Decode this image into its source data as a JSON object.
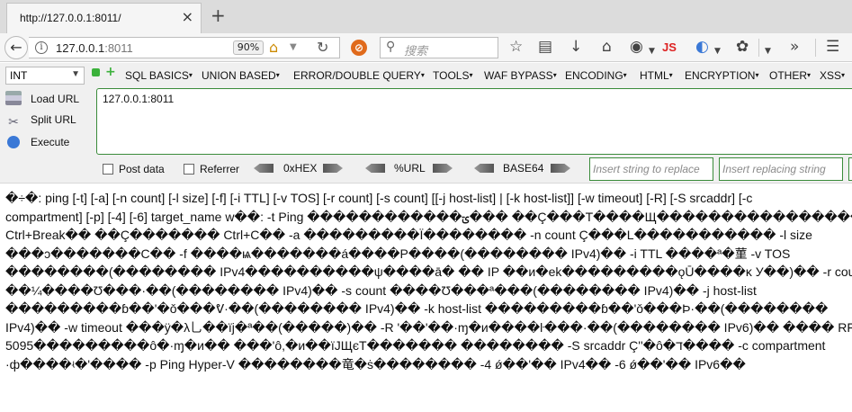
{
  "tab": {
    "title": "http://127.0.0.1:8011/",
    "close": "×"
  },
  "new_tab": "+",
  "nav": {
    "back": "←",
    "info": "i",
    "url_host": "127.0.0.1",
    "url_port": ":8011",
    "zoom": "90%",
    "search_placeholder": "搜索",
    "js_label": "JS"
  },
  "hackbar": {
    "select_value": "INT",
    "menus": [
      "SQL BASICS",
      "UNION BASED",
      "ERROR/DOUBLE QUERY",
      "TOOLS",
      "WAF BYPASS",
      "ENCODING",
      "HTML",
      "ENCRYPTION",
      "OTHER",
      "XSS"
    ],
    "actions": {
      "load": "Load URL",
      "split": "Split URL",
      "execute": "Execute"
    },
    "textarea_value": "127.0.0.1:8011",
    "post_data": "Post data",
    "referrer": "Referrer",
    "enc_hex": "0xHEX",
    "enc_url": "%URL",
    "enc_base64": "BASE64",
    "insert_placeholder": "Insert string to replace",
    "replace_placeholder": "Insert replacing string"
  },
  "content_lines": [
    "�÷�: ping [-t] [-a] [-n count] [-l size] [-f] [-i TTL] [-v TOS] [-r count] [-s count] [[-j host-list] | [-k host-list]] [-w timeout] [-R] [-S srcaddr] [-c",
    "compartment] [-p] [-4] [-6] target_name w��: -t Ping ������������ؾ��� ��Ç���T����Щ��������������������",
    "Ctrl+Break�� ��Ç�������  Ctrl+C��  -a ���������Ï��������  -n count Ç���L�����������  -l size",
    "���ɔ�������C��  -f ����ѩ�������á����P����(��������  IPv4)��  -i TTL ����ª�菫 -v TOS",
    "��������(��������  IPv4����������ψ����ā�  ��  IP  ��и�ek���������ǫŪ����κ  У��)��  -r count",
    "��¼����Ʊ���·��(��������  IPv4)��  -s count  ����Ʊ���ª���(��������  IPv4)��  -j host-list",
    "���������ɓ��ʹ�ǒ���ᕓ·��(��������  IPv4)��  -k host-list ���������ɓ��ʹǒ���Þ·��(��������",
    "IPv4)��  -w timeout ���ÿ�λ乚��ïj�ª��(�����)��  -R  ʹ��ʹ��·ɱ�и����ŀ���·��(��������  IPv6)��  ����  RFC",
    "5095���������ô�·ɱ�и��  ���ʹô,�и��ïJЩєТ�������  ��������  -S srcaddr Ç'ʹ�ô�ד����  -c compartment",
    "·ф����ʵ�ʹ����  -p Ping Hyper-V ��������竜�ṡ��������  -4 ǿ��ʹ��  IPv4��  -6 ǿ��ʹ��  IPv6��"
  ]
}
